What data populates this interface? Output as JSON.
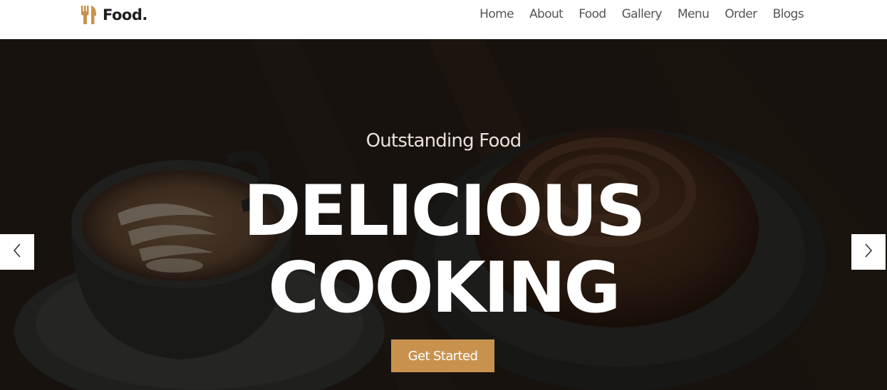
{
  "brand": {
    "name": "Food.",
    "accent_color": "#c8924e",
    "icon": "fork-knife-icon"
  },
  "nav": {
    "items": [
      {
        "label": "Home"
      },
      {
        "label": "About"
      },
      {
        "label": "Food"
      },
      {
        "label": "Gallery"
      },
      {
        "label": "Menu"
      },
      {
        "label": "Order"
      },
      {
        "label": "Blogs"
      }
    ]
  },
  "hero": {
    "subtitle": "Outstanding Food",
    "title_line1": "DELICIOUS",
    "title_line2": "COOKING",
    "cta_label": "Get Started",
    "prev_icon": "chevron-left-icon",
    "next_icon": "chevron-right-icon"
  }
}
